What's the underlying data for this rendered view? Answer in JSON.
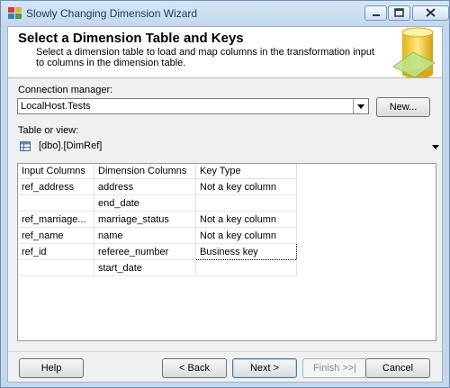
{
  "window": {
    "title": "Slowly Changing Dimension Wizard"
  },
  "header": {
    "title": "Select a Dimension Table and Keys",
    "subtitle": "Select a dimension table to load and map columns in the transformation input to columns in the dimension table."
  },
  "connection": {
    "label": "Connection manager:",
    "value": "LocalHost.Tests",
    "new_button": "New..."
  },
  "table": {
    "label": "Table or view:",
    "value": "[dbo].[DimRef]"
  },
  "grid": {
    "headers": [
      "Input Columns",
      "Dimension Columns",
      "Key Type"
    ],
    "rows": [
      [
        "ref_address",
        "address",
        "Not a key column"
      ],
      [
        "",
        "end_date",
        ""
      ],
      [
        "ref_marriage...",
        "marriage_status",
        "Not a key column"
      ],
      [
        "ref_name",
        "name",
        "Not a key column"
      ],
      [
        "ref_id",
        "referee_number",
        "Business key"
      ],
      [
        "",
        "start_date",
        ""
      ]
    ]
  },
  "footer": {
    "help": "Help",
    "back": "< Back",
    "next": "Next >",
    "finish": "Finish >>|",
    "cancel": "Cancel"
  }
}
